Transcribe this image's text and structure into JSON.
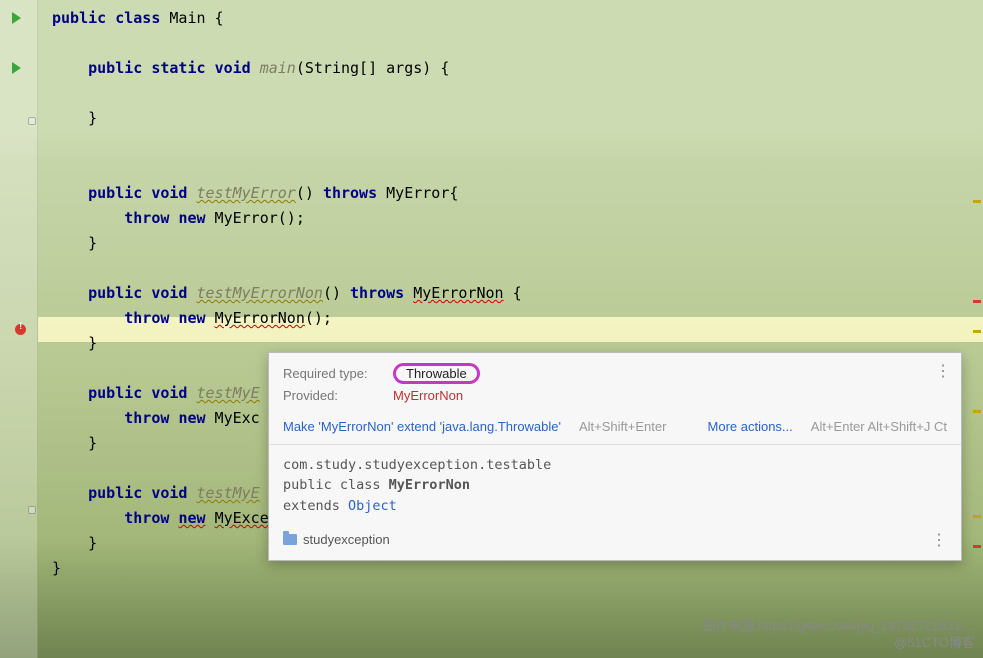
{
  "code": {
    "l1": "public class Main {",
    "l2": "",
    "l3": "    public static void main(String[] args) {",
    "l4": "",
    "l5": "    }",
    "l6": "",
    "l7": "",
    "l8": "    public void testMyError() throws MyError{",
    "l9": "        throw new MyError();",
    "l10": "    }",
    "l11": "",
    "l12": "    public void testMyErrorNon() throws MyErrorNon {",
    "l13": "        throw new MyErrorNon();",
    "l14": "    }",
    "l15": "",
    "l16": "    public void testMyE",
    "l17": "        throw new MyExc",
    "l18": "    }",
    "l19": "",
    "l20": "    public void testMyE",
    "l21": "        throw new MyExceptionNon();",
    "l22": "    }",
    "l23": "}"
  },
  "tooltip": {
    "required_label": "Required type:",
    "required_value": "Throwable",
    "provided_label": "Provided:",
    "provided_value": "MyErrorNon",
    "fix_action": "Make 'MyErrorNon' extend 'java.lang.Throwable'",
    "fix_hint": "Alt+Shift+Enter",
    "more_label": "More actions...",
    "more_hint": "Alt+Enter Alt+Shift+J Ct",
    "doc_package": "com.study.studyexception.testable",
    "doc_decl_prefix": "public class ",
    "doc_decl_class": "MyErrorNon",
    "doc_extends_prefix": "extends ",
    "doc_extends_link": "Object",
    "module_name": "studyexception"
  },
  "watermark": {
    "line1": "图片来源:https://gitee.com/jyq_18792721831/...",
    "line2": "@51CTO博客"
  }
}
